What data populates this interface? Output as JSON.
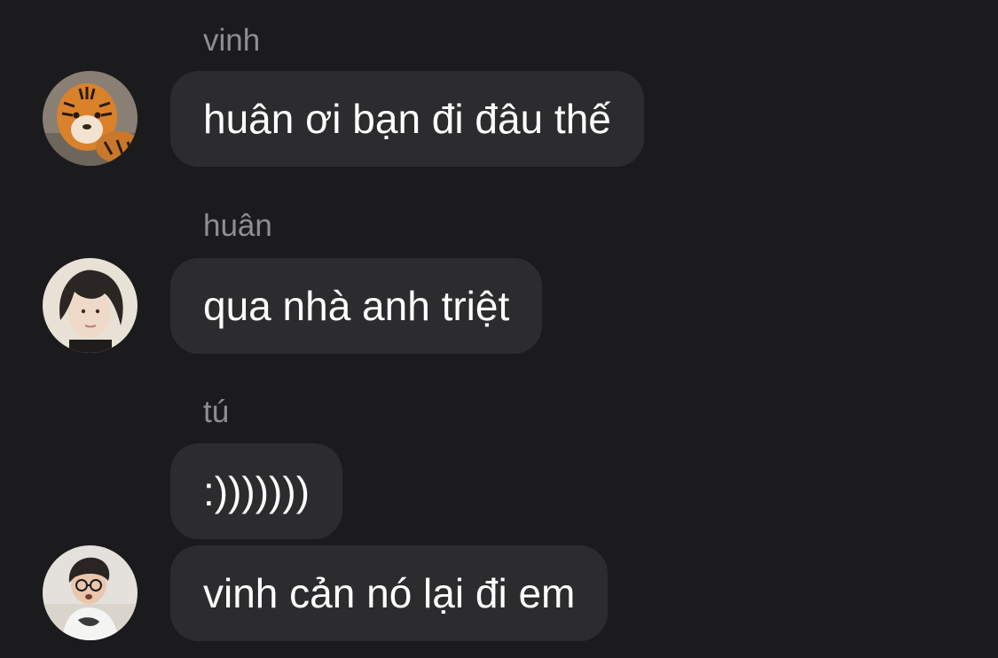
{
  "messages": [
    {
      "sender": "vinh",
      "text": "huân ơi bạn đi đâu thế",
      "avatar": "tiger-avatar"
    },
    {
      "sender": "huân",
      "text": "qua nhà anh triệt",
      "avatar": "person-avatar"
    },
    {
      "sender": "tú",
      "text": ":)))))))",
      "avatar": ""
    },
    {
      "sender": "",
      "text": "vinh cản nó lại đi em",
      "avatar": "glasses-person-avatar"
    }
  ],
  "colors": {
    "background": "#1b1b1d",
    "bubble": "#2c2c2e",
    "sender_name": "#8e8e93",
    "message_text": "#ffffff"
  }
}
